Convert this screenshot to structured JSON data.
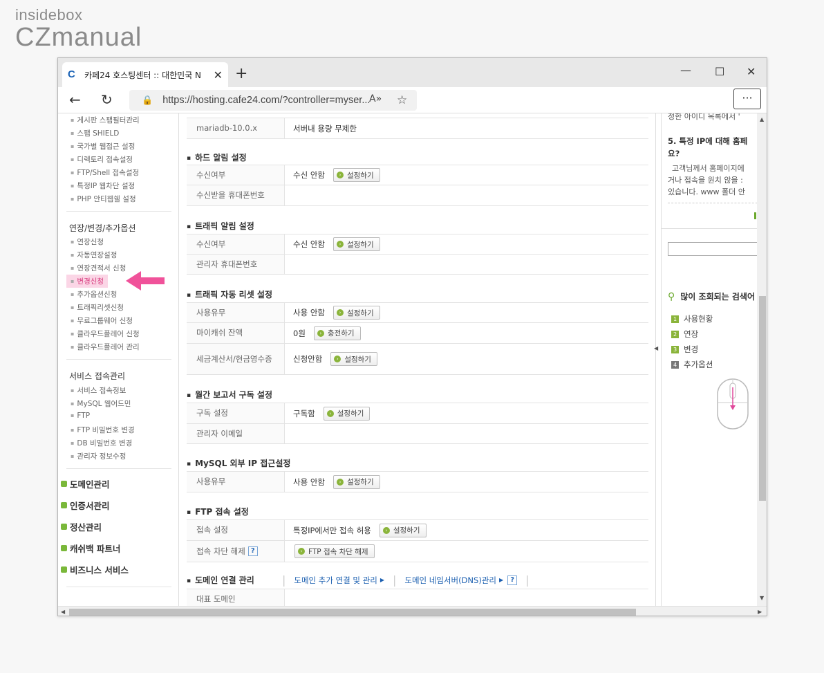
{
  "watermark": {
    "line1": "insidebox",
    "line2": "CZmanual"
  },
  "browser": {
    "tab_title": "카페24 호스팅센터 :: 대한민국 N",
    "url": "https://hosting.cafe24.com/?controller=myser..."
  },
  "sidebar": {
    "group1_items": [
      "게시판 스팸필터관리",
      "스팸 SHIELD",
      "국가별 웹접근 설정",
      "디렉토리 접속설정",
      "FTP/Shell 접속설정",
      "특정IP 웹차단 설정",
      "PHP 안티웹쉘 설정"
    ],
    "group2_title": "연장/변경/추가옵션",
    "group2_items": [
      "연장신청",
      "자동연장설정",
      "연장견적서 신청",
      "변경신청",
      "추가옵션신청",
      "트래픽리셋신청",
      "무료그룹웨어 신청",
      "클라우드플레어 신청",
      "클라우드플레어 관리"
    ],
    "group3_title": "서비스 접속관리",
    "group3_items": [
      "서비스 접속정보",
      "MySQL 웹어드민",
      "FTP",
      "FTP 비밀번호 변경",
      "DB 비밀번호 변경",
      "관리자 정보수정"
    ],
    "categories": [
      "도메인관리",
      "인증서관리",
      "정산관리",
      "캐쉬백 파트너",
      "비즈니스 서비스"
    ]
  },
  "main": {
    "db_row": {
      "label": "mariadb-10.0.x",
      "value": "서버내 용량 무제한"
    },
    "hdd": {
      "title": "하드 알림 설정",
      "rows": [
        {
          "label": "수신여부",
          "value": "수신 안함",
          "button": "설정하기"
        },
        {
          "label": "수신받을 휴대폰번호",
          "value": ""
        }
      ]
    },
    "traffic_alert": {
      "title": "트래픽 알림 설정",
      "rows": [
        {
          "label": "수신여부",
          "value": "수신 안함",
          "button": "설정하기"
        },
        {
          "label": "관리자 휴대폰번호",
          "value": ""
        }
      ]
    },
    "traffic_reset": {
      "title": "트래픽 자동 리셋 설정",
      "rows": [
        {
          "label": "사용유무",
          "value": "사용 안함",
          "button": "설정하기"
        },
        {
          "label": "마이캐쉬 잔액",
          "value": "0원",
          "button": "충전하기"
        },
        {
          "label": "세금계산서/현금영수증",
          "value": "신청안함",
          "button": "설정하기"
        }
      ]
    },
    "monthly": {
      "title": "월간 보고서 구독 설정",
      "rows": [
        {
          "label": "구독 설정",
          "value": "구독함",
          "button": "설정하기"
        },
        {
          "label": "관리자 이메일",
          "value": ""
        }
      ]
    },
    "mysql": {
      "title": "MySQL 외부 IP 접근설정",
      "rows": [
        {
          "label": "사용유무",
          "value": "사용 안함",
          "button": "설정하기"
        }
      ]
    },
    "ftp": {
      "title": "FTP 접속 설정",
      "rows": [
        {
          "label": "접속 설정",
          "value": "특정IP에서만 접속 허용",
          "button": "설정하기"
        },
        {
          "label": "접속 차단 해제",
          "button": "FTP 접속 차단 해제"
        }
      ]
    },
    "domain": {
      "title": "도메인 연결 관리",
      "link1": "도메인 추가 연결 및 관리",
      "link2": "도메인 네임서버(DNS)관리",
      "row_label": "대표 도메인"
    }
  },
  "right": {
    "top_text": "정한 아이디 목록에서 '",
    "faq_title_1": "5. 특정 IP에 대해 홈페",
    "faq_title_2": "요?",
    "faq_body": [
      "고객님께서 홈페이지에",
      "거나 접속을 원치 않을 :",
      "있습니다. www 폴더 안"
    ],
    "popular_title": "많이 조회되는 검색어",
    "popular": [
      "사용현황",
      "연장",
      "변경",
      "추가옵션"
    ]
  }
}
